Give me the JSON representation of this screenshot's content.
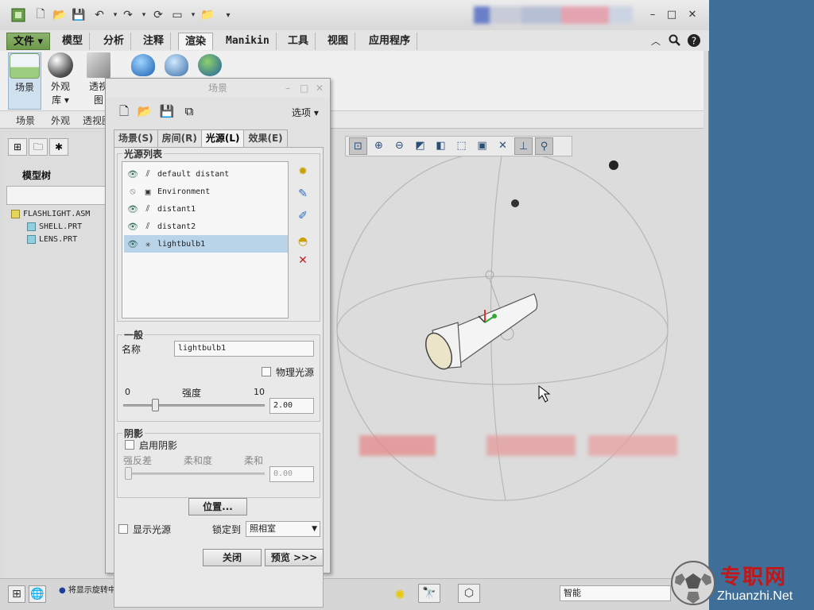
{
  "ribbon_tabs": [
    {
      "label": "文件 ▾"
    },
    {
      "label": "模型"
    },
    {
      "label": "分析"
    },
    {
      "label": "注释"
    },
    {
      "label": "渲染"
    },
    {
      "label": "Manikin"
    },
    {
      "label": "工具"
    },
    {
      "label": "视图"
    },
    {
      "label": "应用程序"
    }
  ],
  "ribbon_buttons": {
    "scene": "场景",
    "appearance": "外观",
    "appearance_sub": "库 ▾",
    "perspective": "透视",
    "perspective_sub": "图"
  },
  "ribbon_groups": [
    "场景",
    "外观",
    "透视图"
  ],
  "model_tree": {
    "header": "模型树",
    "items": [
      "FLASHLIGHT.ASM",
      "SHELL.PRT",
      "LENS.PRT"
    ]
  },
  "dialog": {
    "title": "场景",
    "options_label": "选项 ▾",
    "tabs": [
      "场景(S)",
      "房间(R)",
      "光源(L)",
      "效果(E)"
    ],
    "active_tab": "光源(L)",
    "light_list_legend": "光源列表",
    "lights": [
      {
        "name": "default distant",
        "type": "distant",
        "visible": true
      },
      {
        "name": "Environment",
        "type": "environment",
        "visible": false
      },
      {
        "name": "distant1",
        "type": "distant",
        "visible": true
      },
      {
        "name": "distant2",
        "type": "distant",
        "visible": true
      },
      {
        "name": "lightbulb1",
        "type": "lightbulb",
        "visible": true,
        "selected": true
      }
    ],
    "general_legend": "一般",
    "name_label": "名称",
    "name_value": "lightbulb1",
    "physical_light_label": "物理光源",
    "intensity_label": "强度",
    "intensity_min": "0",
    "intensity_max": "10",
    "intensity_value": "2.00",
    "intensity_level": 0.2,
    "shadow_legend": "阴影",
    "enable_shadow_label": "启用阴影",
    "shadow_strong_label": "强反差",
    "shadow_softness_label": "柔和度",
    "shadow_soft_label": "柔和",
    "shadow_value": "0.00",
    "position_button": "位置...",
    "show_light_label": "显示光源",
    "lock_to_label": "锁定到",
    "lock_to_value": "照相室",
    "close_button": "关闭",
    "preview_button": "预览 >>>"
  },
  "status": {
    "message": "将显示旋转中心。",
    "filter_value": "智能"
  },
  "watermark": {
    "cn": "专职网",
    "en": "Zhuanzhi.Net"
  },
  "colors": {
    "desktop": "#3f6f99",
    "selection": "#b9d3e8",
    "file_tab": "#7aa85a"
  }
}
